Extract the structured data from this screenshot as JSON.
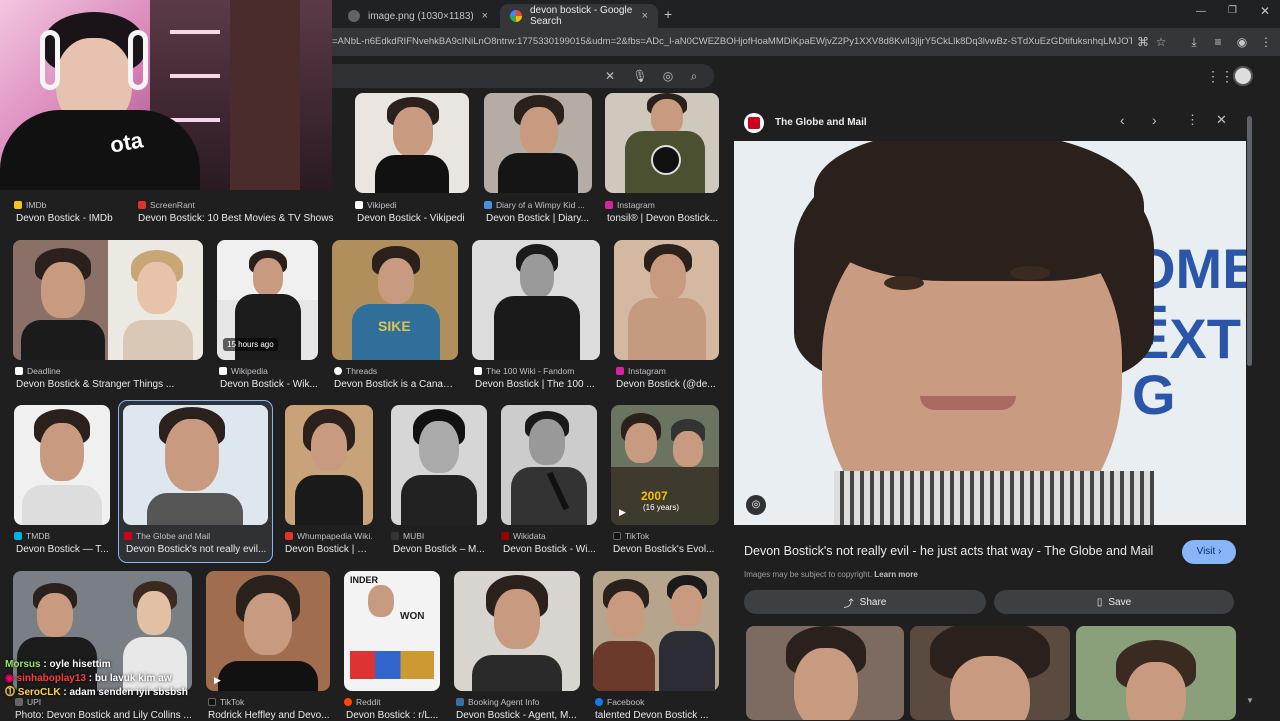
{
  "browser": {
    "tabs": [
      {
        "title": "image.png (1030×1183)",
        "close": "×"
      },
      {
        "title": "devon bostick - Google Search",
        "close": "×"
      }
    ],
    "new_tab": "+",
    "url": "=ANbL-n6EdkdRIFNvehkBA9cINiLnO8ntrw:1775330199015&udm=2&fbs=ADc_l-aN0CWEZBOHjofHoaMMDiKpaEWjvZ2Py1XXV8d8KvlI3jljrY5CkLlk8Dq3lvwBz-STdXuEzGDtifuksnhqLMJOTS9P8-..."
  },
  "search": {
    "query": ""
  },
  "grid": [
    {
      "source": "IMDb",
      "title": "Devon Bostick - IMDb",
      "color": "#f5c518"
    },
    {
      "source": "ScreenRant",
      "title": "Devon Bostick: 10 Best Movies & TV Shows",
      "color": "#e4322a"
    },
    {
      "source": "Vikipedi",
      "title": "Devon Bostick - Vikipedi",
      "color": "#ffffff"
    },
    {
      "source": "Diary of a Wimpy Kid ...",
      "title": "Devon Bostick | Diary...",
      "color": "#4a8fe0"
    },
    {
      "source": "Instagram",
      "title": "tonsil® | Devon Bostick...",
      "color": "#d6249f"
    },
    {
      "source": "Deadline",
      "title": "Devon Bostick & Stranger Things ...",
      "color": "#ffffff"
    },
    {
      "source": "Wikipedia",
      "title": "Devon Bostick - Wik...",
      "badge": "15 hours ago",
      "color": "#ffffff"
    },
    {
      "source": "Threads",
      "title": "Devon Bostick is a Canadi...",
      "color": "#ffffff"
    },
    {
      "source": "The 100 Wiki - Fandom",
      "title": "Devon Bostick | The 100 ...",
      "color": "#ffffff"
    },
    {
      "source": "Instagram",
      "title": "Devon Bostick (@de...",
      "color": "#d6249f"
    },
    {
      "source": "TMDB",
      "title": "Devon Bostick — T...",
      "color": "#01b4e4"
    },
    {
      "source": "The Globe and Mail",
      "title": "Devon Bostick's not really evil...",
      "color": "#d0021b"
    },
    {
      "source": "Whumpapedia Wiki...",
      "title": "Devon Bostick | W...",
      "color": "#e4322a"
    },
    {
      "source": "MUBI",
      "title": "Devon Bostick – M...",
      "color": "#333333"
    },
    {
      "source": "Wikidata",
      "title": "Devon Bostick - Wi...",
      "color": "#990000"
    },
    {
      "source": "TikTok",
      "title": "Devon Bostick's Evol...",
      "overlay": "2007",
      "overlay_sub": "(16 years)",
      "color": "#111111"
    },
    {
      "source": "UPI",
      "title": "Photo: Devon Bostick and Lily Collins ...",
      "color": "#666666"
    },
    {
      "source": "TikTok",
      "title": "Rodrick Heffley and Devo...",
      "color": "#111111"
    },
    {
      "source": "Reddit",
      "title": "Devon Bostick : r/L...",
      "color": "#ff4500"
    },
    {
      "source": "Booking Agent Info",
      "title": "Devon Bostick - Agent, M...",
      "color": "#3a6ea5"
    },
    {
      "source": "Facebook",
      "title": "talented Devon Bostick ...",
      "color": "#1877f2"
    }
  ],
  "panel": {
    "source": "The Globe and Mail",
    "title": "Devon Bostick's not really evil - he just acts that way - The Globe and Mail",
    "visit": "Visit",
    "copyright": "Images may be subject to copyright.",
    "learn_more": "Learn more",
    "share": "Share",
    "save": "Save",
    "bg_text_1": "OME T",
    "bg_text_2": "EXT G"
  },
  "chat": [
    {
      "user": "Morsus",
      "msg": "oyle hisettim",
      "color": "#9be36a"
    },
    {
      "user": "sinhaboplay13",
      "msg": "bu lavuk kim aw",
      "color": "#ff3b3b"
    },
    {
      "user": "SeroCLK",
      "msg": "adam senden iyii sbsbsh",
      "color": "#ffd24a"
    }
  ]
}
